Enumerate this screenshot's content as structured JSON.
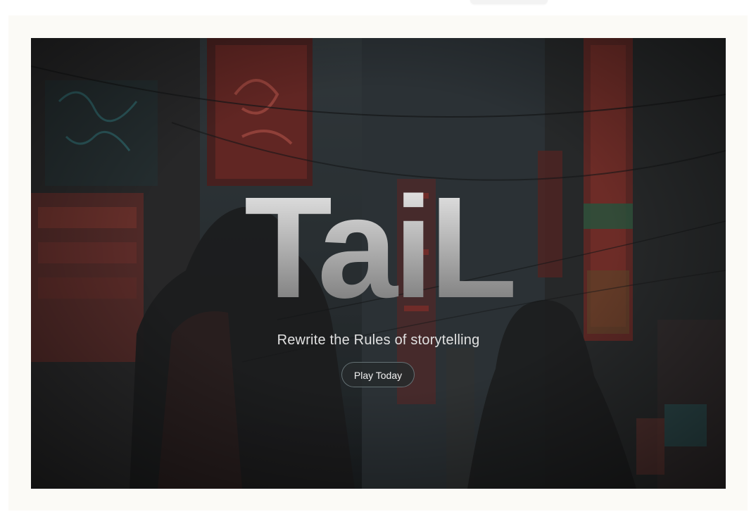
{
  "hero": {
    "logo_text": "TaiL",
    "tagline": "Rewrite the Rules of storytelling",
    "cta_label": "Play Today"
  },
  "colors": {
    "page_background": "#fbfaf6",
    "hero_overlay": "#2a2d30",
    "logo_gradient_top": "#f5f5f5",
    "logo_gradient_bottom": "#6a6a6a",
    "neon_red": "#c8362c",
    "neon_teal": "#2f8e92"
  }
}
